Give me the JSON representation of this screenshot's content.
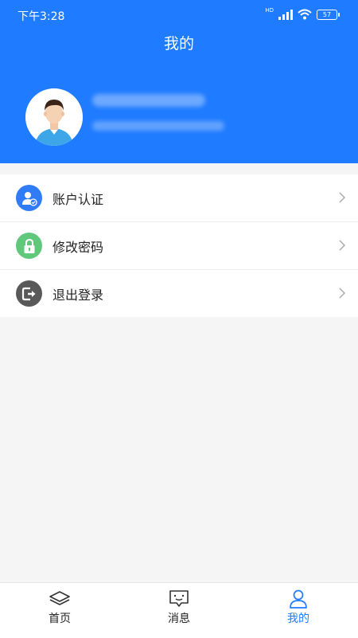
{
  "status_bar": {
    "time": "下午3:28",
    "hd": "HD",
    "battery": "57"
  },
  "header": {
    "title": "我的"
  },
  "menu": {
    "items": [
      {
        "label": "账户认证",
        "icon": "account-verify-icon",
        "color": "#2f7cf6"
      },
      {
        "label": "修改密码",
        "icon": "lock-icon",
        "color": "#5fc87a"
      },
      {
        "label": "退出登录",
        "icon": "logout-icon",
        "color": "#595959"
      }
    ]
  },
  "tabbar": {
    "tabs": [
      {
        "label": "首页",
        "icon": "home-layers-icon",
        "active": false
      },
      {
        "label": "消息",
        "icon": "message-icon",
        "active": false
      },
      {
        "label": "我的",
        "icon": "user-icon",
        "active": true
      }
    ]
  },
  "colors": {
    "primary": "#1f7bff",
    "background": "#f5f5f5"
  }
}
